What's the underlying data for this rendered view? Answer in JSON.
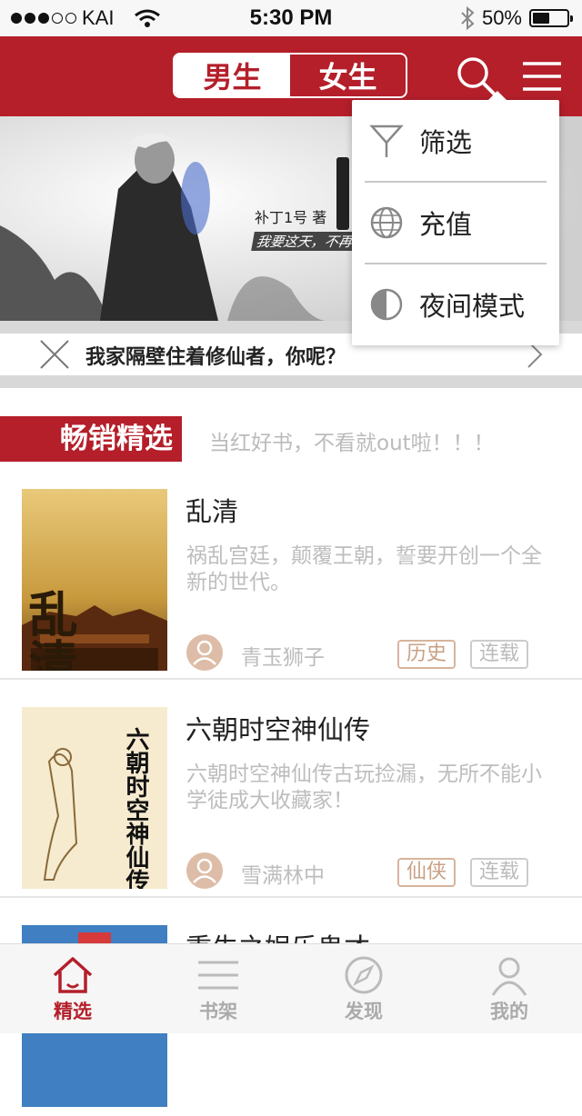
{
  "status_bar": {
    "carrier": "KAI",
    "time": "5:30 PM",
    "battery": "50%",
    "battery_level": 0.5
  },
  "header": {
    "gender_tabs": [
      {
        "label": "男生",
        "selected": true
      },
      {
        "label": "女生",
        "selected": false
      }
    ],
    "icons": {
      "search": "search-icon",
      "menu": "menu-icon"
    },
    "accent": "#b41f2a"
  },
  "banner": {
    "author": "补丁1号 著",
    "slogan": "我要这天，不再",
    "caption": "我家隔壁住着修仙者，你呢？"
  },
  "dropdown_menu": [
    {
      "label": "筛选",
      "icon": "filter-icon"
    },
    {
      "label": "充值",
      "icon": "globe-icon"
    },
    {
      "label": "夜间模式",
      "icon": "night-mode-icon"
    }
  ],
  "section": {
    "title": "畅销精选",
    "subtitle": "当红好书，不看就out啦！！！"
  },
  "books": [
    {
      "title": "乱清",
      "description": "祸乱宫廷，颠覆王朝，誓要开创一个全新的世代。",
      "author": "青玉狮子",
      "genre": "历史",
      "status": "连载",
      "cover_text": "乱清"
    },
    {
      "title": "六朝时空神仙传",
      "description": "六朝时空神仙传古玩捡漏，无所不能小学徒成大收藏家！",
      "author": "雪满林中",
      "genre": "仙侠",
      "status": "连载",
      "cover_text": "六朝时空神仙传"
    },
    {
      "title": "重生之娱乐鬼才",
      "description": "",
      "author": "",
      "genre": "",
      "status": "",
      "cover_text": ""
    }
  ],
  "tab_bar": [
    {
      "label": "精选",
      "icon": "home-icon",
      "active": true
    },
    {
      "label": "书架",
      "icon": "bookshelf-icon",
      "active": false
    },
    {
      "label": "发现",
      "icon": "compass-icon",
      "active": false
    },
    {
      "label": "我的",
      "icon": "user-icon",
      "active": false
    }
  ]
}
